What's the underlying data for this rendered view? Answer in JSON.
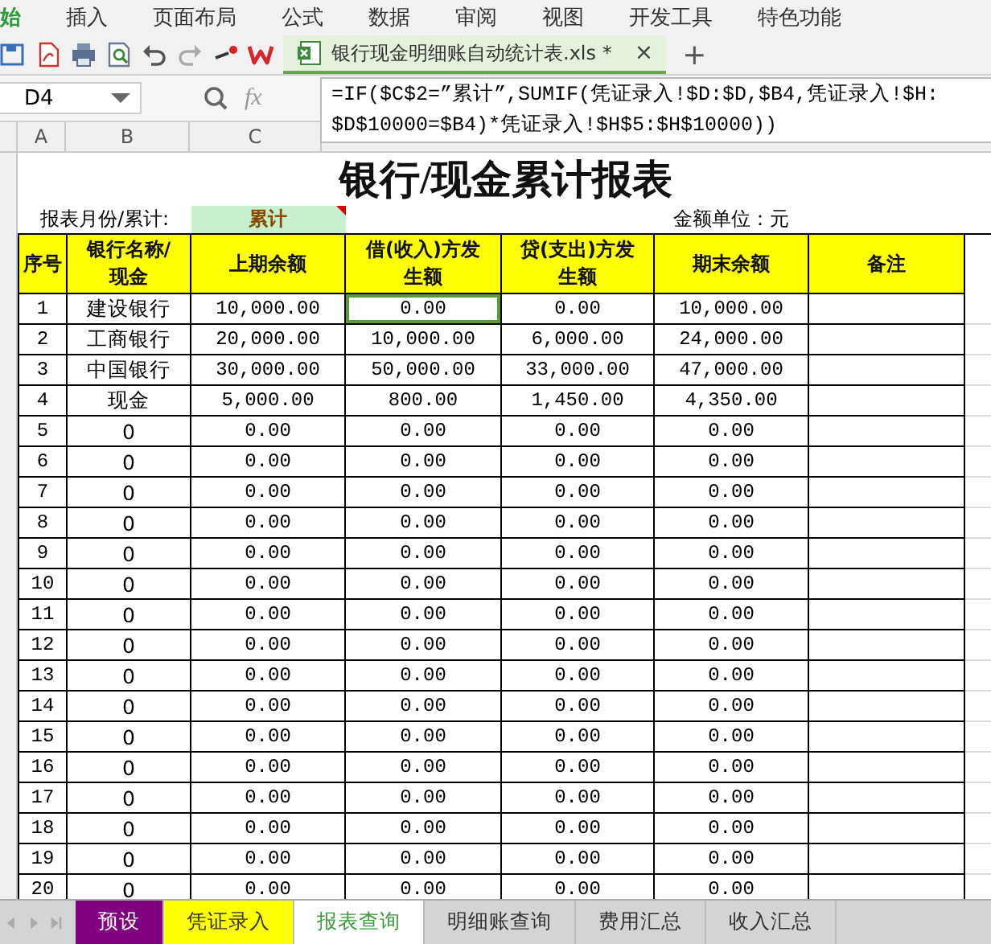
{
  "menu": [
    {
      "label": "始",
      "selected": true
    },
    {
      "label": "插入",
      "selected": false
    },
    {
      "label": "页面布局",
      "selected": false
    },
    {
      "label": "公式",
      "selected": false
    },
    {
      "label": "数据",
      "selected": false
    },
    {
      "label": "审阅",
      "selected": false
    },
    {
      "label": "视图",
      "selected": false
    },
    {
      "label": "开发工具",
      "selected": false
    },
    {
      "label": "特色功能",
      "selected": false
    }
  ],
  "document_tab": {
    "title": "银行现金明细账自动统计表.xls *",
    "close": "×",
    "new_tab": "+"
  },
  "formula_bar": {
    "cell": "D4",
    "fx": "fx",
    "formula": "=IF($C$2=”累计”,SUMIF(凭证录入!$D:$D,$B4,凭证录入!$H:\n$D$10000=$B4)*凭证录入!$H$5:$H$10000))"
  },
  "column_letters": [
    "A",
    "B",
    "C"
  ],
  "sheet": {
    "title": "银行/现金累计报表",
    "period_label": "报表月份/累计:",
    "period_value": "累计",
    "period_comment": true,
    "unit_label": "金额单位：元",
    "headers": [
      "序号",
      "银行名称/现金",
      "上期余额",
      "借(收入)方发生额",
      "贷(支出)方发生额",
      "期末余额",
      "备注"
    ],
    "rows": [
      {
        "cells": [
          "1",
          "建设银行",
          "10,000.00",
          "0.00",
          "0.00",
          "10,000.00"
        ],
        "selected": true
      },
      {
        "cells": [
          "2",
          "工商银行",
          "20,000.00",
          "10,000.00",
          "6,000.00",
          "24,000.00"
        ],
        "selected": false
      },
      {
        "cells": [
          "3",
          "中国银行",
          "30,000.00",
          "50,000.00",
          "33,000.00",
          "47,000.00"
        ],
        "selected": false
      },
      {
        "cells": [
          "4",
          "现金",
          "5,000.00",
          "800.00",
          "1,450.00",
          "4,350.00"
        ],
        "selected": false
      },
      {
        "cells": [
          "5",
          "0",
          "0.00",
          "0.00",
          "0.00",
          "0.00"
        ],
        "selected": false
      },
      {
        "cells": [
          "6",
          "0",
          "0.00",
          "0.00",
          "0.00",
          "0.00"
        ],
        "selected": false
      },
      {
        "cells": [
          "7",
          "0",
          "0.00",
          "0.00",
          "0.00",
          "0.00"
        ],
        "selected": false
      },
      {
        "cells": [
          "8",
          "0",
          "0.00",
          "0.00",
          "0.00",
          "0.00"
        ],
        "selected": false
      },
      {
        "cells": [
          "9",
          "0",
          "0.00",
          "0.00",
          "0.00",
          "0.00"
        ],
        "selected": false
      },
      {
        "cells": [
          "10",
          "0",
          "0.00",
          "0.00",
          "0.00",
          "0.00"
        ],
        "selected": false
      },
      {
        "cells": [
          "11",
          "0",
          "0.00",
          "0.00",
          "0.00",
          "0.00"
        ],
        "selected": false
      },
      {
        "cells": [
          "12",
          "0",
          "0.00",
          "0.00",
          "0.00",
          "0.00"
        ],
        "selected": false
      },
      {
        "cells": [
          "13",
          "0",
          "0.00",
          "0.00",
          "0.00",
          "0.00"
        ],
        "selected": false
      },
      {
        "cells": [
          "14",
          "0",
          "0.00",
          "0.00",
          "0.00",
          "0.00"
        ],
        "selected": false
      },
      {
        "cells": [
          "15",
          "0",
          "0.00",
          "0.00",
          "0.00",
          "0.00"
        ],
        "selected": false
      },
      {
        "cells": [
          "16",
          "0",
          "0.00",
          "0.00",
          "0.00",
          "0.00"
        ],
        "selected": false
      },
      {
        "cells": [
          "17",
          "0",
          "0.00",
          "0.00",
          "0.00",
          "0.00"
        ],
        "selected": false
      },
      {
        "cells": [
          "18",
          "0",
          "0.00",
          "0.00",
          "0.00",
          "0.00"
        ],
        "selected": false
      },
      {
        "cells": [
          "19",
          "0",
          "0.00",
          "0.00",
          "0.00",
          "0.00"
        ],
        "selected": false
      },
      {
        "cells": [
          "20",
          "0",
          "0.00",
          "0.00",
          "0.00",
          "0.00"
        ],
        "selected": false
      }
    ]
  },
  "sheet_tabs": [
    {
      "label": "预设",
      "color": "#800080",
      "selected": false
    },
    {
      "label": "凭证录入",
      "color": "#ffff00",
      "selected": false
    },
    {
      "label": "报表查询",
      "color": "#ffffff",
      "selected": true
    },
    {
      "label": "明细账查询",
      "color": "#d4d4d4",
      "selected": false
    },
    {
      "label": "费用汇总",
      "color": "#d4d4d4",
      "selected": false
    },
    {
      "label": "收入汇总",
      "color": "#d4d4d4",
      "selected": false
    }
  ]
}
